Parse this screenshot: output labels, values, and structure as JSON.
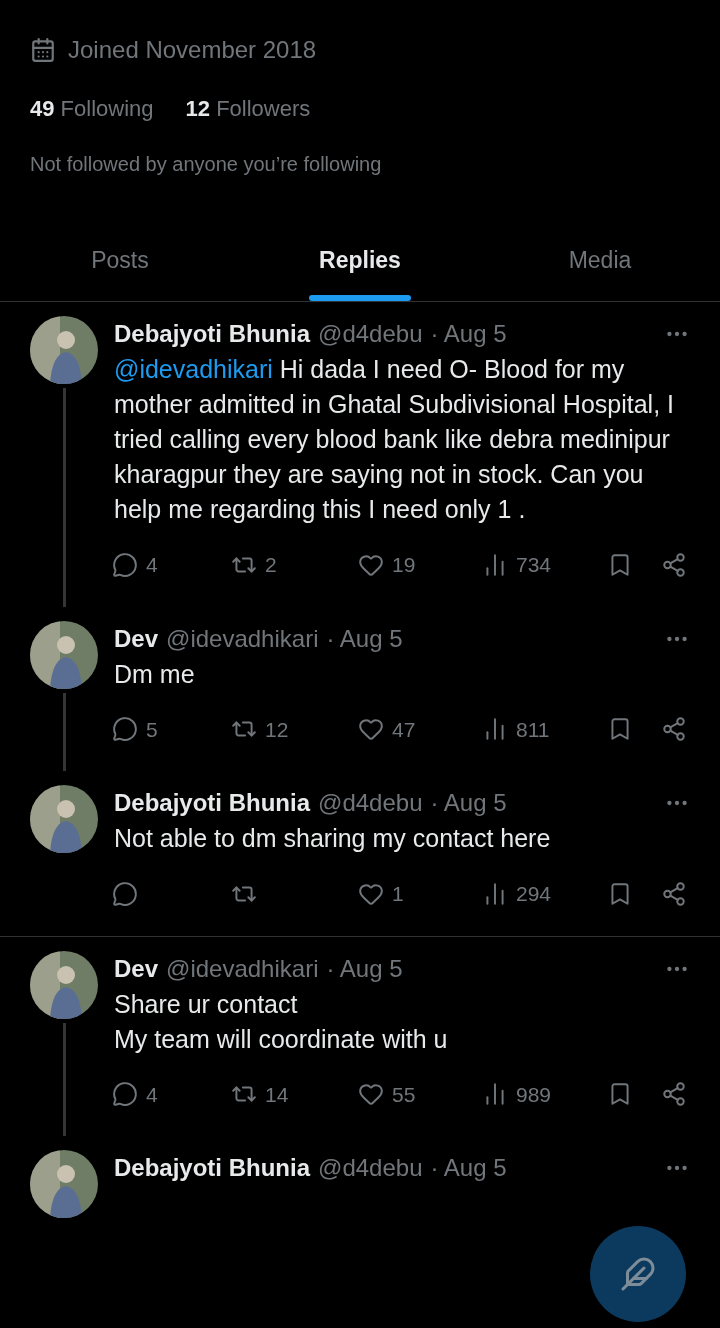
{
  "profile": {
    "joined": "Joined November 2018",
    "following_count": "49",
    "following_label": "Following",
    "followers_count": "12",
    "followers_label": "Followers",
    "followed_by": "Not followed by anyone you’re following"
  },
  "tabs": [
    {
      "label": "Posts",
      "selected": false
    },
    {
      "label": "Replies",
      "selected": true
    },
    {
      "label": "Media",
      "selected": false
    }
  ],
  "posts": [
    {
      "name": "Debajyoti Bhunia",
      "handle": "@d4debu",
      "date": "· Aug 5",
      "mention": "@idevadhikari",
      "text": "Hi dada I need O- Blood for my mother admitted in Ghatal Subdivisional Hospital, I tried calling every blood bank like debra medinipur kharagpur they are saying not in stock. Can you help me regarding this I need only 1 .",
      "replies": "4",
      "reposts": "2",
      "likes": "19",
      "views": "734",
      "thread_line": true,
      "divider_after": false
    },
    {
      "name": "Dev",
      "handle": "@idevadhikari",
      "date": "· Aug 5",
      "text": "Dm me",
      "replies": "5",
      "reposts": "12",
      "likes": "47",
      "views": "811",
      "thread_line": true,
      "divider_after": false
    },
    {
      "name": "Debajyoti Bhunia",
      "handle": "@d4debu",
      "date": "· Aug 5",
      "text": "Not able to dm sharing my contact here",
      "likes": "1",
      "views": "294",
      "thread_line": false,
      "divider_after": true
    },
    {
      "name": "Dev",
      "handle": "@idevadhikari",
      "date": "· Aug 5",
      "text": "Share ur contact\nMy team will coordinate with u",
      "replies": "4",
      "reposts": "14",
      "likes": "55",
      "views": "989",
      "thread_line": true,
      "divider_after": false
    },
    {
      "name": "Debajyoti Bhunia",
      "handle": "@d4debu",
      "date": "· Aug 5",
      "thread_line": false,
      "divider_after": false
    }
  ]
}
